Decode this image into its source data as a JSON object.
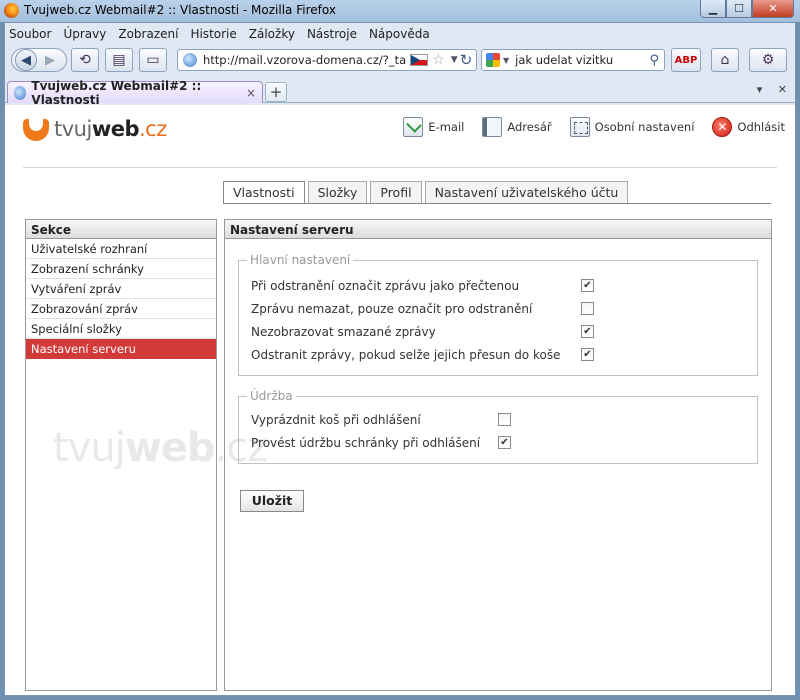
{
  "window": {
    "title": "Tvujweb.cz Webmail#2 :: Vlastnosti - Mozilla Firefox"
  },
  "menu": [
    "Soubor",
    "Úpravy",
    "Zobrazení",
    "Historie",
    "Záložky",
    "Nástroje",
    "Nápověda"
  ],
  "nav": {
    "url": "http://mail.vzorova-domena.cz/?_ta",
    "search": "jak udelat vizitku"
  },
  "tab": {
    "title": "Tvujweb.cz Webmail#2 :: Vlastnosti"
  },
  "logo": {
    "part1": "tvuj",
    "part2": "web",
    "part3": ".cz"
  },
  "toplinks": {
    "email": "E-mail",
    "address": "Adresář",
    "settings": "Osobní nastavení",
    "logout": "Odhlásit"
  },
  "tabs": [
    "Vlastnosti",
    "Složky",
    "Profil",
    "Nastavení uživatelského účtu"
  ],
  "sidebar": {
    "header": "Sekce",
    "items": [
      "Uživatelské rozhraní",
      "Zobrazení schránky",
      "Vytváření zpráv",
      "Zobrazování zpráv",
      "Speciální složky",
      "Nastavení serveru"
    ],
    "active_index": 5
  },
  "main": {
    "header": "Nastavení serveru",
    "main_settings": {
      "legend": "Hlavní nastavení",
      "options": [
        {
          "label": "Při odstranění označit zprávu jako přečtenou",
          "checked": true
        },
        {
          "label": "Zprávu nemazat, pouze označit pro odstranění",
          "checked": false
        },
        {
          "label": "Nezobrazovat smazané zprávy",
          "checked": true
        },
        {
          "label": "Odstranit zprávy, pokud selže jejich přesun do koše",
          "checked": true
        }
      ]
    },
    "maintenance": {
      "legend": "Údržba",
      "options": [
        {
          "label": "Vyprázdnit koš při odhlášení",
          "checked": false
        },
        {
          "label": "Provést údržbu schránky při odhlášení",
          "checked": true
        }
      ]
    },
    "save_label": "Uložit"
  },
  "watermark": {
    "part1": "tvuj",
    "part2": "web",
    "part3": ".cz"
  }
}
